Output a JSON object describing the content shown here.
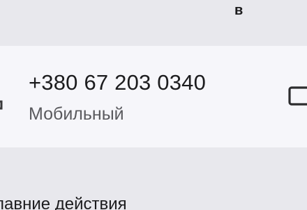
{
  "header": {
    "label": "в"
  },
  "contact": {
    "phone_number": "+380 67 203 0340",
    "phone_type": "Мобильный"
  },
  "icons": {
    "call": "phone-icon",
    "message": "message-icon"
  },
  "recent_actions": {
    "title": "лавние действия"
  },
  "colors": {
    "background": "#e8e8ed",
    "card": "#f6f6fa",
    "text_primary": "#1c1c1e",
    "text_secondary": "#5a5a5e"
  }
}
